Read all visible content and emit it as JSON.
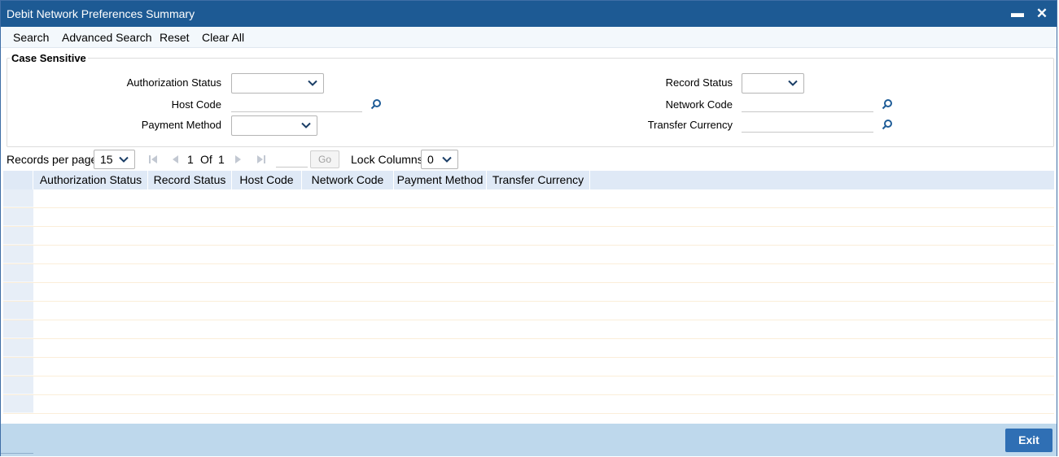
{
  "window": {
    "title": "Debit Network Preferences Summary",
    "minimize_glyph": "▬",
    "close_glyph": "✕"
  },
  "toolbar": {
    "search": "Search",
    "advanced_search": "Advanced Search",
    "reset": "Reset",
    "clear_all": "Clear All"
  },
  "criteria": {
    "legend": "Case Sensitive",
    "authorization_status": {
      "label": "Authorization Status",
      "value": ""
    },
    "host_code": {
      "label": "Host Code",
      "value": ""
    },
    "payment_method": {
      "label": "Payment Method",
      "value": ""
    },
    "record_status": {
      "label": "Record Status",
      "value": ""
    },
    "network_code": {
      "label": "Network Code",
      "value": ""
    },
    "transfer_currency": {
      "label": "Transfer Currency",
      "value": ""
    }
  },
  "pager": {
    "records_per_page_label": "Records per page",
    "records_per_page": "15",
    "current_page": "1",
    "of_label": "Of",
    "total_pages": "1",
    "go_label": "Go",
    "lock_columns_label": "Lock Columns",
    "lock_columns": "0"
  },
  "grid": {
    "columns": [
      "Authorization Status",
      "Record Status",
      "Host Code",
      "Network Code",
      "Payment Method",
      "Transfer Currency"
    ]
  },
  "footer": {
    "exit": "Exit"
  },
  "colors": {
    "titlebar": "#1d5a94",
    "footer": "#bed8ec",
    "grid_header": "#dfe9f6",
    "exit_button": "#2f6fb4"
  },
  "icons": {
    "lookup": "magnifier-icon",
    "dropdown": "chevron-down-icon"
  }
}
